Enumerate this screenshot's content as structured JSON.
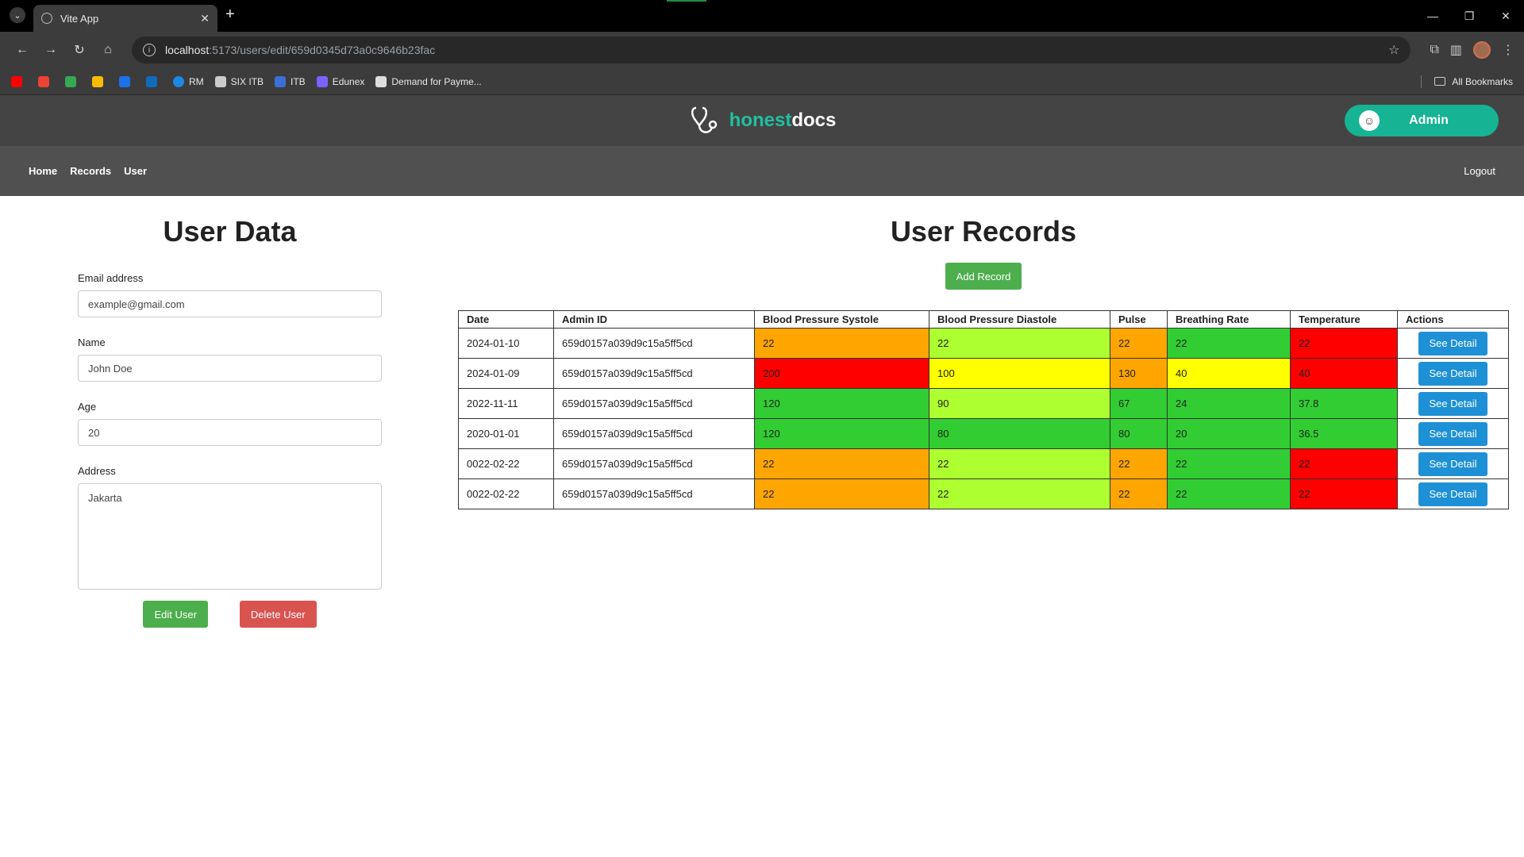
{
  "browser": {
    "tab_title": "Vite App",
    "url_host": "localhost",
    "url_path": ":5173/users/edit/659d0345d73a0c9646b23fac",
    "bookmarks": [
      {
        "label": "",
        "color": "#ff0000"
      },
      {
        "label": "",
        "color": "#ea4335"
      },
      {
        "label": "",
        "color": "#34a853"
      },
      {
        "label": "",
        "color": "#fbbc04"
      },
      {
        "label": "",
        "color": "#1a73e8"
      },
      {
        "label": "",
        "color": "#0f6cbd"
      },
      {
        "label": "RM",
        "color": "#1e88e5"
      },
      {
        "label": "SIX ITB",
        "color": "#cccccc"
      },
      {
        "label": "ITB",
        "color": "#3b6fd8"
      },
      {
        "label": "Edunex",
        "color": "#7b61ff"
      },
      {
        "label": "Demand for Payme...",
        "color": "#dddddd"
      }
    ],
    "all_bookmarks": "All Bookmarks"
  },
  "header": {
    "brand_part1": "honest",
    "brand_part2": "docs",
    "admin_label": "Admin"
  },
  "nav": {
    "items": [
      "Home",
      "Records",
      "User"
    ],
    "logout": "Logout"
  },
  "user_data": {
    "title": "User Data",
    "email_label": "Email address",
    "email_value": "example@gmail.com",
    "name_label": "Name",
    "name_value": "John Doe",
    "age_label": "Age",
    "age_value": "20",
    "address_label": "Address",
    "address_value": "Jakarta",
    "edit_button": "Edit User",
    "delete_button": "Delete User"
  },
  "records": {
    "title": "User Records",
    "add_button": "Add Record",
    "columns": [
      "Date",
      "Admin ID",
      "Blood Pressure Systole",
      "Blood Pressure Diastole",
      "Pulse",
      "Breathing Rate",
      "Temperature",
      "Actions"
    ],
    "action_label": "See Detail",
    "status_colors": {
      "orange": "#ffa500",
      "lime": "#adff2f",
      "green": "#32cd32",
      "red": "#ff0000",
      "yellow": "#ffff00"
    },
    "rows": [
      {
        "date": "2024-01-10",
        "admin_id": "659d0157a039d9c15a5ff5cd",
        "systole": "22",
        "diastole": "22",
        "pulse": "22",
        "breathing": "22",
        "temperature": "22",
        "colors": [
          "orange",
          "lime",
          "orange",
          "green",
          "red"
        ]
      },
      {
        "date": "2024-01-09",
        "admin_id": "659d0157a039d9c15a5ff5cd",
        "systole": "200",
        "diastole": "100",
        "pulse": "130",
        "breathing": "40",
        "temperature": "40",
        "colors": [
          "red",
          "yellow",
          "orange",
          "yellow",
          "red"
        ]
      },
      {
        "date": "2022-11-11",
        "admin_id": "659d0157a039d9c15a5ff5cd",
        "systole": "120",
        "diastole": "90",
        "pulse": "67",
        "breathing": "24",
        "temperature": "37.8",
        "colors": [
          "green",
          "lime",
          "green",
          "green",
          "green"
        ]
      },
      {
        "date": "2020-01-01",
        "admin_id": "659d0157a039d9c15a5ff5cd",
        "systole": "120",
        "diastole": "80",
        "pulse": "80",
        "breathing": "20",
        "temperature": "36.5",
        "colors": [
          "green",
          "green",
          "green",
          "green",
          "green"
        ]
      },
      {
        "date": "0022-02-22",
        "admin_id": "659d0157a039d9c15a5ff5cd",
        "systole": "22",
        "diastole": "22",
        "pulse": "22",
        "breathing": "22",
        "temperature": "22",
        "colors": [
          "orange",
          "lime",
          "orange",
          "green",
          "red"
        ]
      },
      {
        "date": "0022-02-22",
        "admin_id": "659d0157a039d9c15a5ff5cd",
        "systole": "22",
        "diastole": "22",
        "pulse": "22",
        "breathing": "22",
        "temperature": "22",
        "colors": [
          "orange",
          "lime",
          "orange",
          "green",
          "red"
        ]
      }
    ]
  }
}
